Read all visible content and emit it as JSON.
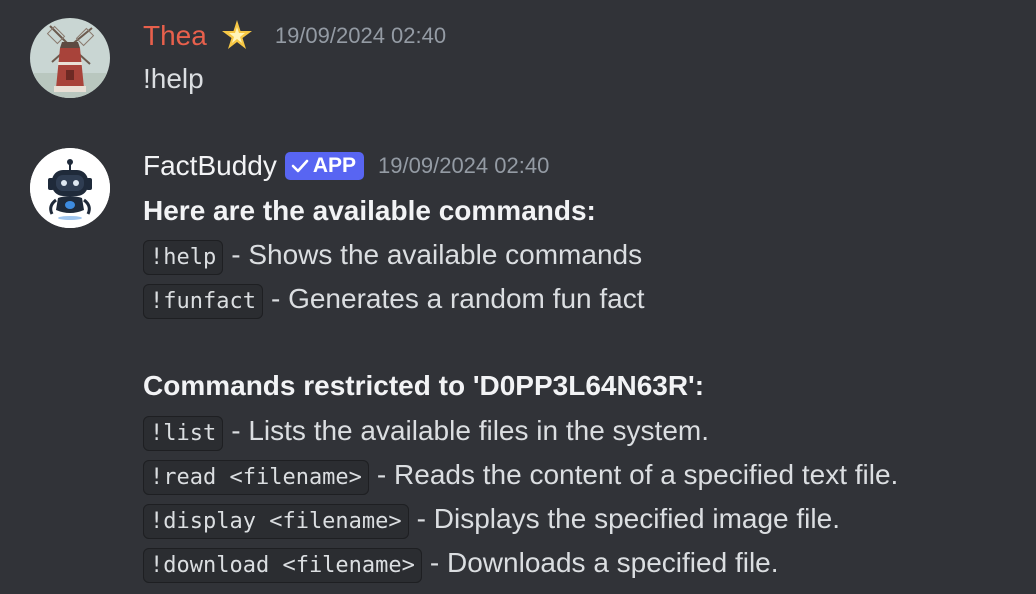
{
  "colors": {
    "background": "#313338",
    "username_thea": "#e8604c",
    "username_bot": "#f2f3f5",
    "app_badge": "#5865f2",
    "timestamp": "#949ba4",
    "text": "#dbdee1"
  },
  "messages": [
    {
      "author": "Thea",
      "author_icon": "sparkle-icon",
      "avatar": "windmill-avatar",
      "timestamp": "19/09/2024 02:40",
      "content": "!help"
    },
    {
      "author": "FactBuddy",
      "badge": "APP",
      "badge_icon": "checkmark-icon",
      "avatar": "robot-avatar",
      "timestamp": "19/09/2024 02:40",
      "heading_1": "Here are the available commands:",
      "commands_public": [
        {
          "code": "!help",
          "description": "- Shows the available commands"
        },
        {
          "code": "!funfact",
          "description": "- Generates a random fun fact"
        }
      ],
      "heading_2": "Commands restricted to 'D0PP3L64N63R':",
      "commands_restricted": [
        {
          "code": "!list",
          "description": "- Lists the available files in the system."
        },
        {
          "code": "!read <filename>",
          "description": "- Reads the content of a specified text file."
        },
        {
          "code": "!display <filename>",
          "description": "- Displays the specified image file."
        },
        {
          "code": "!download <filename>",
          "description": "- Downloads a specified file."
        }
      ]
    }
  ]
}
